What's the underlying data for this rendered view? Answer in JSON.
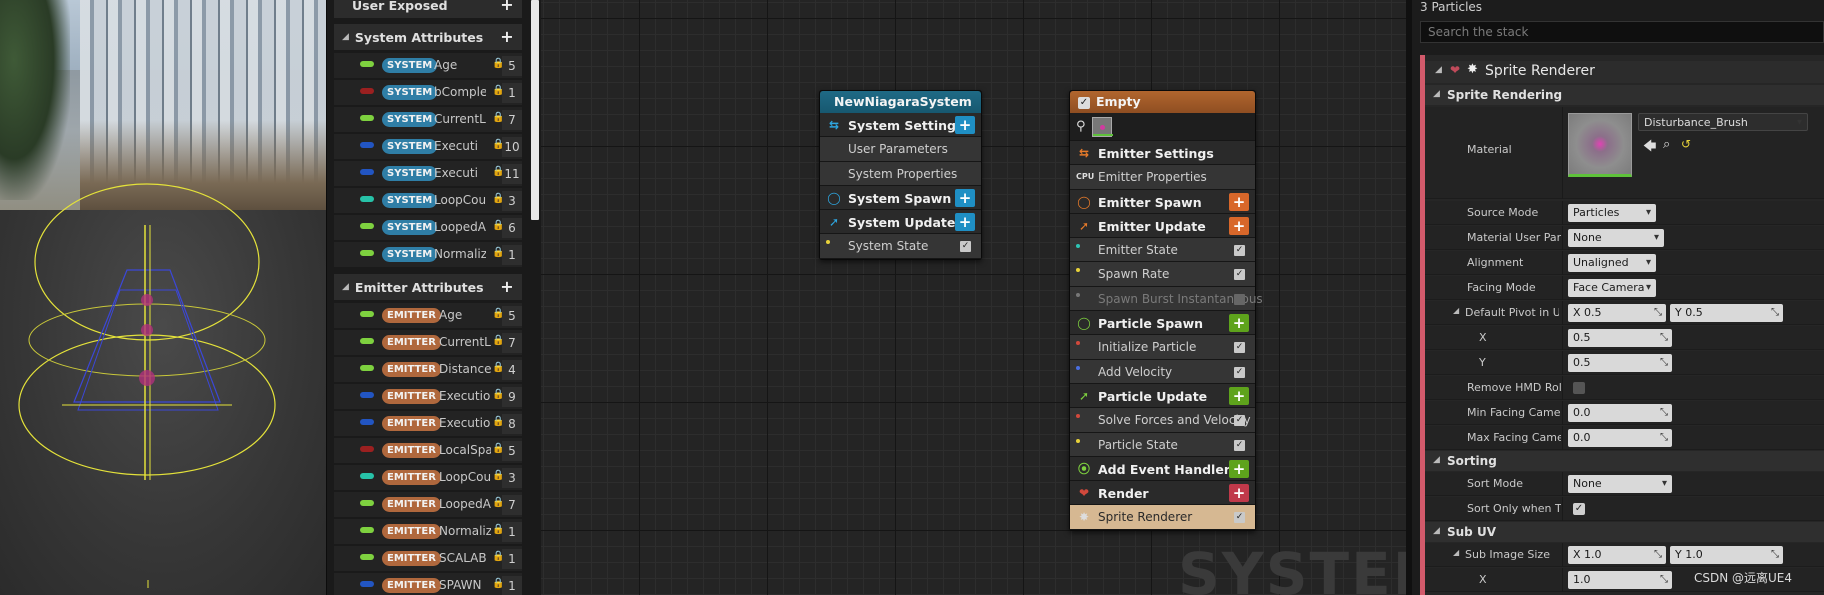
{
  "params": {
    "user_exposed": "User Exposed",
    "system_attrs_title": "System Attributes",
    "emitter_attrs_title": "Emitter Attributes",
    "system_attrs": [
      {
        "tag": "SYSTEM",
        "name": "Age",
        "count": "5",
        "color": "#7ed13f"
      },
      {
        "tag": "SYSTEM",
        "name": "bComple",
        "count": "1",
        "color": "#9b2020"
      },
      {
        "tag": "SYSTEM",
        "name": "CurrentL",
        "count": "7",
        "color": "#7ed13f"
      },
      {
        "tag": "SYSTEM",
        "name": "Executi",
        "count": "10",
        "color": "#2255c2"
      },
      {
        "tag": "SYSTEM",
        "name": "Executi",
        "count": "11",
        "color": "#2255c2"
      },
      {
        "tag": "SYSTEM",
        "name": "LoopCou",
        "count": "3",
        "color": "#27c2a8"
      },
      {
        "tag": "SYSTEM",
        "name": "LoopedA",
        "count": "6",
        "color": "#7ed13f"
      },
      {
        "tag": "SYSTEM",
        "name": "Normaliz",
        "count": "1",
        "color": "#7ed13f"
      }
    ],
    "emitter_attrs": [
      {
        "tag": "EMITTER",
        "name": "Age",
        "count": "5",
        "color": "#7ed13f"
      },
      {
        "tag": "EMITTER",
        "name": "CurrentL",
        "count": "7",
        "color": "#7ed13f"
      },
      {
        "tag": "EMITTER",
        "name": "Distance",
        "count": "4",
        "color": "#7ed13f"
      },
      {
        "tag": "EMITTER",
        "name": "Executio",
        "count": "9",
        "color": "#2255c2"
      },
      {
        "tag": "EMITTER",
        "name": "Executio",
        "count": "8",
        "color": "#2255c2"
      },
      {
        "tag": "EMITTER",
        "name": "LocalSpa",
        "count": "5",
        "color": "#9b2020"
      },
      {
        "tag": "EMITTER",
        "name": "LoopCou",
        "count": "3",
        "color": "#27c2a8"
      },
      {
        "tag": "EMITTER",
        "name": "LoopedA",
        "count": "7",
        "color": "#7ed13f"
      },
      {
        "tag": "EMITTER",
        "name": "Normaliz",
        "count": "1",
        "color": "#7ed13f"
      },
      {
        "tag": "EMITTER",
        "name": "SCALAB",
        "count": "1",
        "color": "#7ed13f"
      },
      {
        "tag": "EMITTER",
        "name": "SPAWN",
        "count": "1",
        "color": "#2255c2"
      }
    ]
  },
  "system_node": {
    "title": "NewNiagaraSystem",
    "settings": "System Settings",
    "user_params": "User Parameters",
    "sys_props": "System Properties",
    "spawn": "System Spawn",
    "update": "System Update",
    "state": "System State"
  },
  "emitter_node": {
    "title": "Empty",
    "rows": [
      {
        "label": "Emitter Settings",
        "kind": "hdr",
        "icon": "⇆",
        "icon_color": "#e87b2a",
        "add": false
      },
      {
        "label": "Emitter Properties",
        "kind": "sub",
        "icon": "CPU",
        "add": false
      },
      {
        "label": "Emitter Spawn",
        "kind": "hdr",
        "icon": "◯",
        "icon_color": "#e87b2a",
        "add": true,
        "add_color": "#d8672a"
      },
      {
        "label": "Emitter Update",
        "kind": "hdr",
        "icon": "➚",
        "icon_color": "#e87b2a",
        "add": true,
        "add_color": "#d8672a"
      },
      {
        "label": "Emitter State",
        "kind": "sub",
        "dot": "#2ec4b4",
        "check": true
      },
      {
        "label": "Spawn Rate",
        "kind": "sub",
        "dot": "#e8d23a",
        "check": true
      },
      {
        "label": "Spawn Burst Instantaneous",
        "kind": "sub dim",
        "dot": "#777777",
        "check": false
      },
      {
        "label": "Particle Spawn",
        "kind": "hdr",
        "icon": "◯",
        "icon_color": "#7ed13f",
        "add": true,
        "add_color": "#5ea31c"
      },
      {
        "label": "Initialize Particle",
        "kind": "sub",
        "dot": "#d2493c",
        "check": true
      },
      {
        "label": "Add Velocity",
        "kind": "sub",
        "dot": "#4a6fe0",
        "check": true
      },
      {
        "label": "Particle Update",
        "kind": "hdr",
        "icon": "➚",
        "icon_color": "#7ed13f",
        "add": true,
        "add_color": "#5ea31c"
      },
      {
        "label": "Solve Forces and Velocity",
        "kind": "sub",
        "dot": "#d2493c",
        "check": true
      },
      {
        "label": "Particle State",
        "kind": "sub",
        "dot": "#e8d23a",
        "check": true
      },
      {
        "label": "Add Event Handler",
        "kind": "hdr",
        "icon": "⦿",
        "icon_color": "#7ed13f",
        "add": true,
        "add_color": "#5ea31c"
      },
      {
        "label": "Render",
        "kind": "hdr",
        "icon": "❤",
        "icon_color": "#d2493c",
        "add": true,
        "add_color": "#c0394a"
      },
      {
        "label": "Sprite Renderer",
        "kind": "sub sel",
        "icon": "✸",
        "check": true
      }
    ]
  },
  "watermark": "SYSTEM",
  "details": {
    "count_text": "3 Particles",
    "search_placeholder": "Search the stack",
    "module_title": "Sprite Renderer",
    "sprite_rendering": "Sprite Rendering",
    "material_label": "Material",
    "material_value": "Disturbance_Brush",
    "rows1": [
      {
        "k": "Source Mode",
        "v": "Particles",
        "type": "dd"
      },
      {
        "k": "Material User Paran",
        "v": "None",
        "type": "dd"
      },
      {
        "k": "Alignment",
        "v": "Unaligned",
        "type": "dd"
      },
      {
        "k": "Facing Mode",
        "v": "Face Camera",
        "type": "dd"
      }
    ],
    "pivot_label": "Default Pivot in UV",
    "pivot_x": "X  0.5",
    "pivot_y": "Y  0.5",
    "x_label": "X",
    "x_value": "0.5",
    "y_label": "Y",
    "y_value": "0.5",
    "remove_hmd": "Remove HMD Roll",
    "min_facing": "Min Facing Camera",
    "min_facing_value": "0.0",
    "max_facing": "Max Facing Camera",
    "max_facing_value": "0.0",
    "sorting": "Sorting",
    "sort_mode": "Sort Mode",
    "sort_mode_value": "None",
    "sort_only": "Sort Only when Tra",
    "sub_uv": "Sub UV",
    "sub_image_size": "Sub Image Size",
    "sub_x": "X  1.0",
    "sub_y": "Y  1.0",
    "sub_x_label": "X",
    "sub_x_value": "1.0"
  },
  "credit": "CSDN @远离UE4"
}
